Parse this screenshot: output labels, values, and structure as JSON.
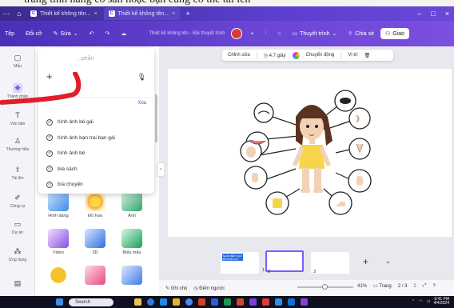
{
  "browser": {
    "tabs": [
      {
        "title": "Thiết kế không tên..."
      },
      {
        "title": "Thiết kế không tên..."
      }
    ],
    "new_tab": "+",
    "window_controls": [
      "–",
      "□",
      "×"
    ]
  },
  "menubar": {
    "file": "Tệp",
    "resize": "Đổi cỡ",
    "edit": "Sửa",
    "doc_title": "Thiết kế không tên - Bài thuyết trình",
    "present": "Thuyết trình",
    "share": "Chia sẻ",
    "deliver": "Giao"
  },
  "rail": [
    {
      "label": "Mẫu"
    },
    {
      "label": "Thành phần"
    },
    {
      "label": "Văn bản"
    },
    {
      "label": "Thương hiệu"
    },
    {
      "label": "Tải lên"
    },
    {
      "label": "Công cụ"
    },
    {
      "label": "Dự án"
    },
    {
      "label": "Ứng dụng"
    },
    {
      "label": ""
    }
  ],
  "search_popup": {
    "placeholder": "...phần",
    "view_all": "Xóa",
    "history": [
      "hình ảnh bé gái",
      "hình ảnh bạn trai bạn gái",
      "hình ảnh bé",
      "bìa sách",
      "bìa chuyện"
    ]
  },
  "elements_grid": [
    {
      "label": "Hình dạng",
      "color": "#3d8be8"
    },
    {
      "label": "Đồ họa",
      "color": "#f4a41c"
    },
    {
      "label": "Ảnh",
      "color": "#2fa36b"
    },
    {
      "label": "Video",
      "color": "#8a4de0"
    },
    {
      "label": "3D",
      "color": "#2a6fe0"
    },
    {
      "label": "Biểu mẫu",
      "color": "#19a05a"
    },
    {
      "label": "",
      "color": "#f6c229"
    },
    {
      "label": "",
      "color": "#e84a7a"
    },
    {
      "label": "",
      "color": "#3f7be6"
    }
  ],
  "context_toolbar": {
    "edit": "Chỉnh sửa",
    "duration": "4.7 giây",
    "animate": "Chuyển động",
    "position": "Vị trí"
  },
  "filmstrip": {
    "pages": [
      "1",
      "2",
      "3"
    ],
    "first_thumb_text": "NHẬN BIẾT CÁC BỘ PHẬN CƠ THỂ"
  },
  "statusbar": {
    "notes": "Ghi chú",
    "timer": "Đếm ngược",
    "zoom": "41%",
    "page_label": "Trang",
    "page_count": "2 / 3"
  },
  "taskbar": {
    "search": "Search",
    "time": "9:41 PM",
    "date": "4/4/2024"
  },
  "colors": {
    "accent": "#6a48d8",
    "annotation": "#e01e2a",
    "canvas_bg": "#e8e9ee"
  }
}
